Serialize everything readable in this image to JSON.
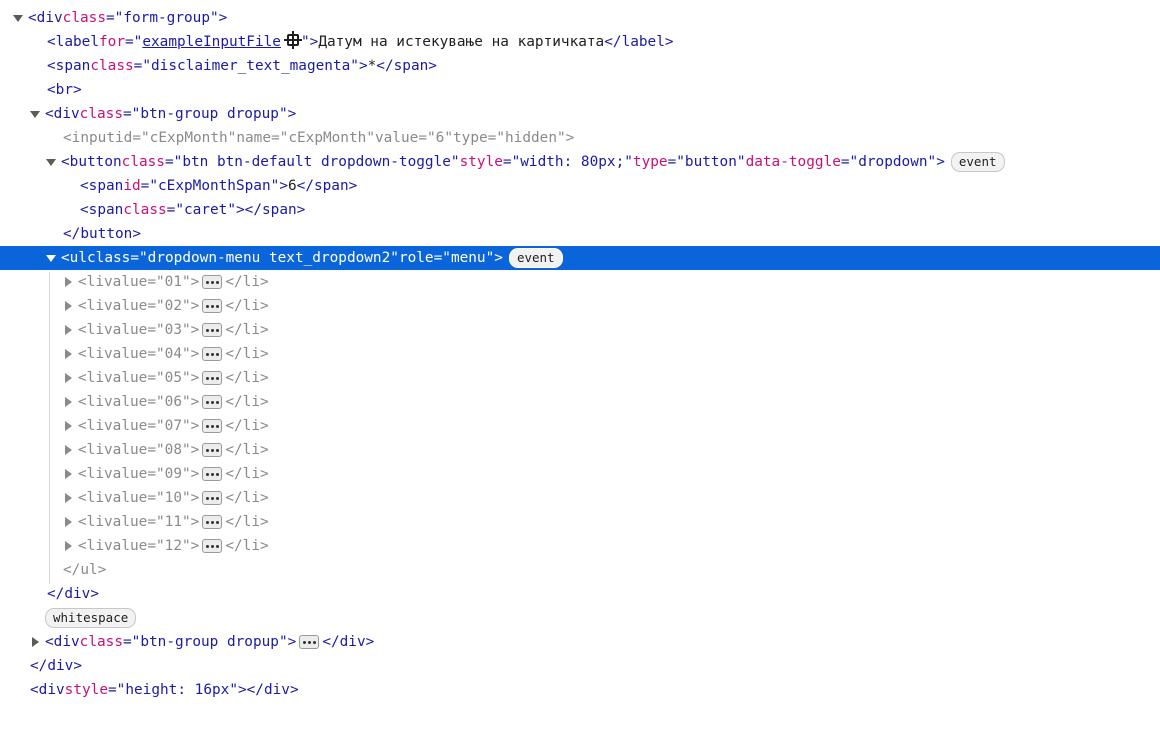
{
  "nodes": {
    "formgroup_open": {
      "tag": "div",
      "attr": "class",
      "value": "form-group"
    },
    "label": {
      "tag": "label",
      "attr": "for",
      "value": "exampleInputFile",
      "text": "Датум на истекување на картичката",
      "close": "label"
    },
    "span_magenta": {
      "tag": "span",
      "attr": "class",
      "value": "disclaimer_text_magenta",
      "text": "*",
      "close": "span"
    },
    "br": {
      "tag": "br"
    },
    "btngroup1": {
      "tag": "div",
      "attr": "class",
      "value": "btn-group dropup"
    },
    "input": {
      "tag": "input",
      "a1": "id",
      "v1": "cExpMonth",
      "a2": "name",
      "v2": "cExpMonth",
      "a3": "value",
      "v3": "6",
      "a4": "type",
      "v4": "hidden"
    },
    "button": {
      "tag": "button",
      "a1": "class",
      "v1": "btn btn-default dropdown-toggle",
      "a2": "style",
      "v2": "width: 80px;",
      "a3": "type",
      "v3": "button",
      "a4": "data-toggle",
      "v4": "dropdown",
      "badge": "event"
    },
    "span_month": {
      "tag": "span",
      "attr": "id",
      "value": "cExpMonthSpan",
      "text": "6",
      "close": "span"
    },
    "span_caret": {
      "tag": "span",
      "attr": "class",
      "value": "caret",
      "close": "span"
    },
    "button_close": {
      "tag": "button"
    },
    "ul": {
      "tag": "ul",
      "a1": "class",
      "v1": "dropdown-menu text_dropdown2",
      "a2": "role",
      "v2": "menu",
      "badge": "event"
    },
    "li_items": [
      {
        "tag": "li",
        "attr": "value",
        "value": "01",
        "close": "li"
      },
      {
        "tag": "li",
        "attr": "value",
        "value": "02",
        "close": "li"
      },
      {
        "tag": "li",
        "attr": "value",
        "value": "03",
        "close": "li"
      },
      {
        "tag": "li",
        "attr": "value",
        "value": "04",
        "close": "li"
      },
      {
        "tag": "li",
        "attr": "value",
        "value": "05",
        "close": "li"
      },
      {
        "tag": "li",
        "attr": "value",
        "value": "06",
        "close": "li"
      },
      {
        "tag": "li",
        "attr": "value",
        "value": "07",
        "close": "li"
      },
      {
        "tag": "li",
        "attr": "value",
        "value": "08",
        "close": "li"
      },
      {
        "tag": "li",
        "attr": "value",
        "value": "09",
        "close": "li"
      },
      {
        "tag": "li",
        "attr": "value",
        "value": "10",
        "close": "li"
      },
      {
        "tag": "li",
        "attr": "value",
        "value": "11",
        "close": "li"
      },
      {
        "tag": "li",
        "attr": "value",
        "value": "12",
        "close": "li"
      }
    ],
    "ul_close": {
      "tag": "ul"
    },
    "div_close1": {
      "tag": "div"
    },
    "whitespace_badge": "whitespace",
    "btngroup2": {
      "tag": "div",
      "attr": "class",
      "value": "btn-group dropup",
      "close": "div"
    },
    "div_close2": {
      "tag": "div"
    },
    "spacer": {
      "tag": "div",
      "attr": "style",
      "value": "height: 16px",
      "close": "div"
    }
  },
  "colors": {
    "selection": "#0b65da",
    "tag": "#1a1aa6",
    "attribute": "#c80f7a"
  }
}
